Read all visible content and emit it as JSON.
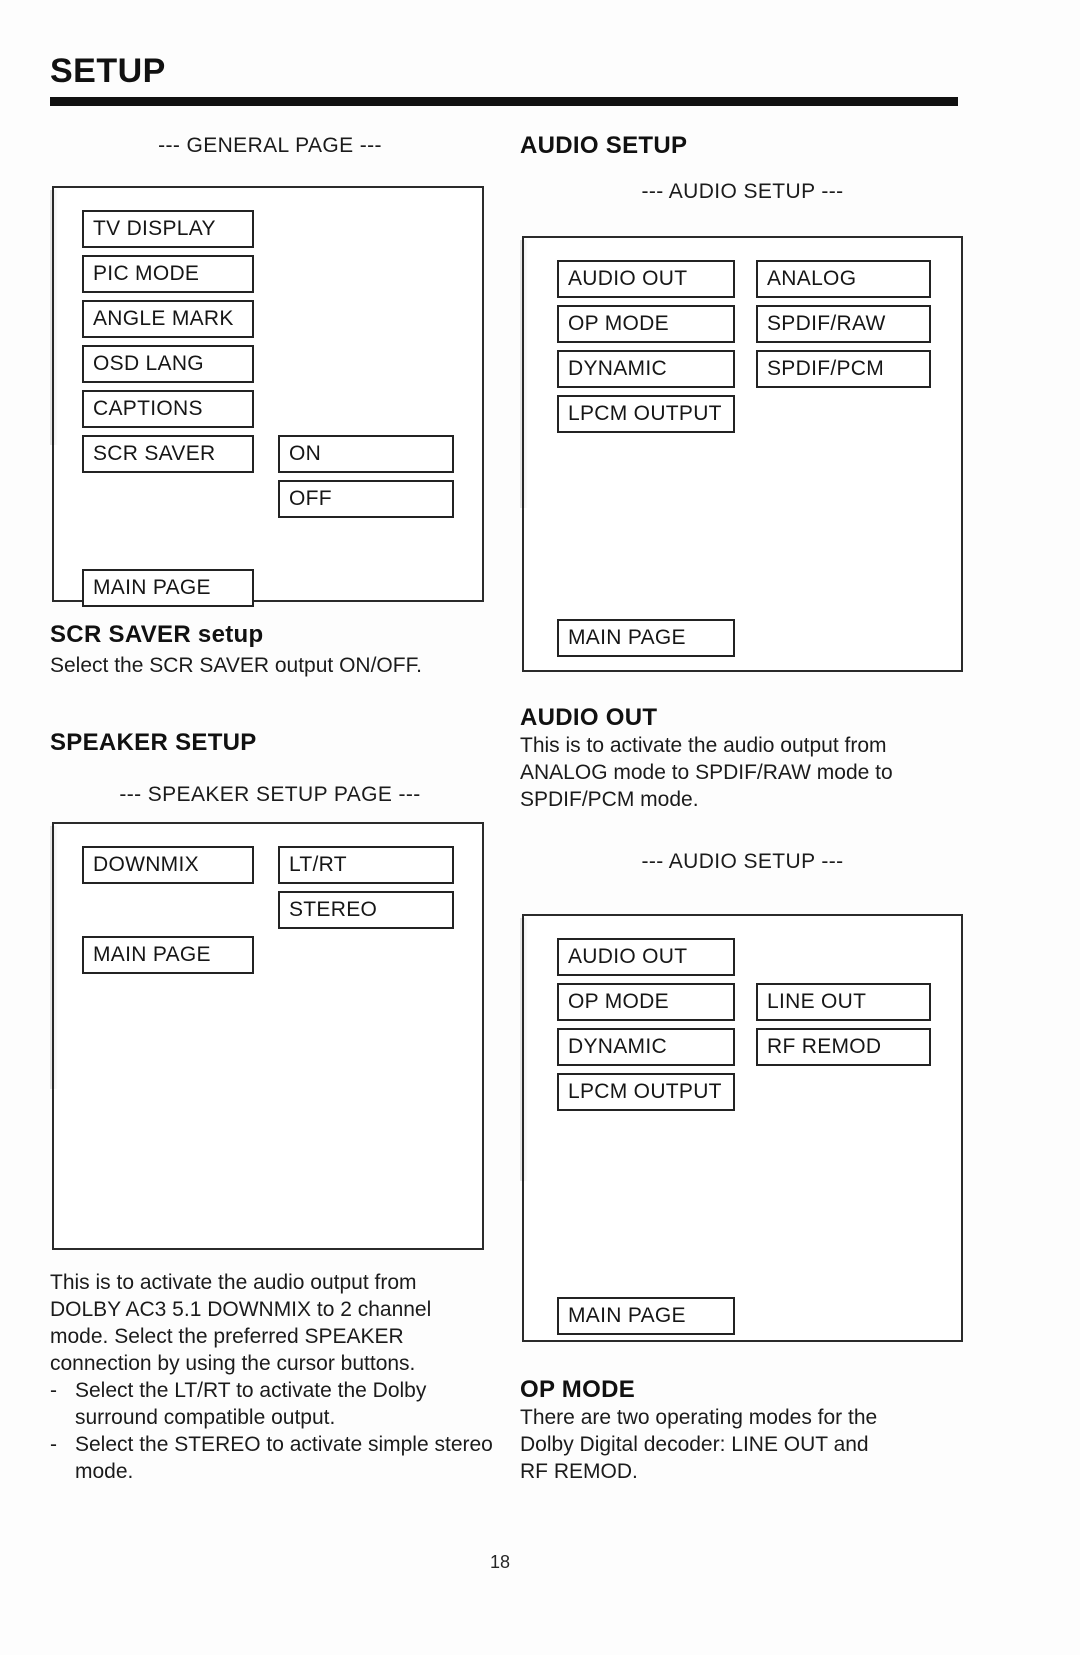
{
  "page": {
    "title": "SETUP",
    "folio": "18"
  },
  "left": {
    "general_page": {
      "caption": "--- GENERAL PAGE ---",
      "menu_items": [
        {
          "label": "TV DISPLAY"
        },
        {
          "label": "PIC MODE"
        },
        {
          "label": "ANGLE MARK"
        },
        {
          "label": "OSD LANG"
        },
        {
          "label": "CAPTIONS"
        },
        {
          "label": "SCR SAVER"
        }
      ],
      "submenu_items": [
        {
          "label": "ON"
        },
        {
          "label": "OFF"
        }
      ],
      "main_page_label": "MAIN PAGE"
    },
    "scr_saver": {
      "heading_strong": "SCR SAVER",
      "heading_rest": " setup",
      "description": "Select the SCR SAVER output ON/OFF."
    },
    "speaker_setup": {
      "heading": "SPEAKER SETUP",
      "caption": "--- SPEAKER SETUP PAGE ---",
      "menu_items": [
        {
          "label": "DOWNMIX"
        }
      ],
      "submenu_items": [
        {
          "label": "LT/RT"
        },
        {
          "label": "STEREO"
        }
      ],
      "main_page_label": "MAIN PAGE",
      "description_lines": [
        "This is to activate the audio output from",
        "DOLBY AC3 5.1 DOWNMIX to 2 channel",
        "mode.  Select the preferred SPEAKER",
        "connection by using the cursor buttons."
      ],
      "bullets": [
        {
          "dash": "-",
          "text": "Select the LT/RT to activate the Dolby surround compatible output."
        },
        {
          "dash": "-",
          "text": "Select the STEREO to activate simple stereo mode."
        }
      ]
    }
  },
  "right": {
    "audio_setup": {
      "heading": "AUDIO SETUP",
      "caption": "--- AUDIO SETUP ---",
      "menu_items": [
        {
          "label": "AUDIO OUT"
        },
        {
          "label": "OP MODE"
        },
        {
          "label": "DYNAMIC"
        },
        {
          "label": "LPCM OUTPUT"
        }
      ],
      "submenu_items": [
        {
          "label": "ANALOG"
        },
        {
          "label": "SPDIF/RAW"
        },
        {
          "label": "SPDIF/PCM"
        }
      ],
      "main_page_label": "MAIN PAGE"
    },
    "audio_out": {
      "heading": "AUDIO OUT",
      "description_lines": [
        "This is to activate the audio output from",
        "ANALOG mode to SPDIF/RAW mode to",
        "SPDIF/PCM mode."
      ]
    },
    "audio_setup_2": {
      "caption": "--- AUDIO SETUP ---",
      "menu_items": [
        {
          "label": "AUDIO OUT"
        },
        {
          "label": "OP MODE"
        },
        {
          "label": "DYNAMIC"
        },
        {
          "label": "LPCM OUTPUT"
        }
      ],
      "submenu_items": [
        {
          "label": "LINE OUT"
        },
        {
          "label": "RF REMOD"
        }
      ],
      "main_page_label": "MAIN PAGE"
    },
    "op_mode": {
      "heading": "OP MODE",
      "description_lines": [
        "There are two operating modes for the",
        "Dolby Digital decoder:  LINE OUT and",
        "RF REMOD."
      ]
    }
  }
}
